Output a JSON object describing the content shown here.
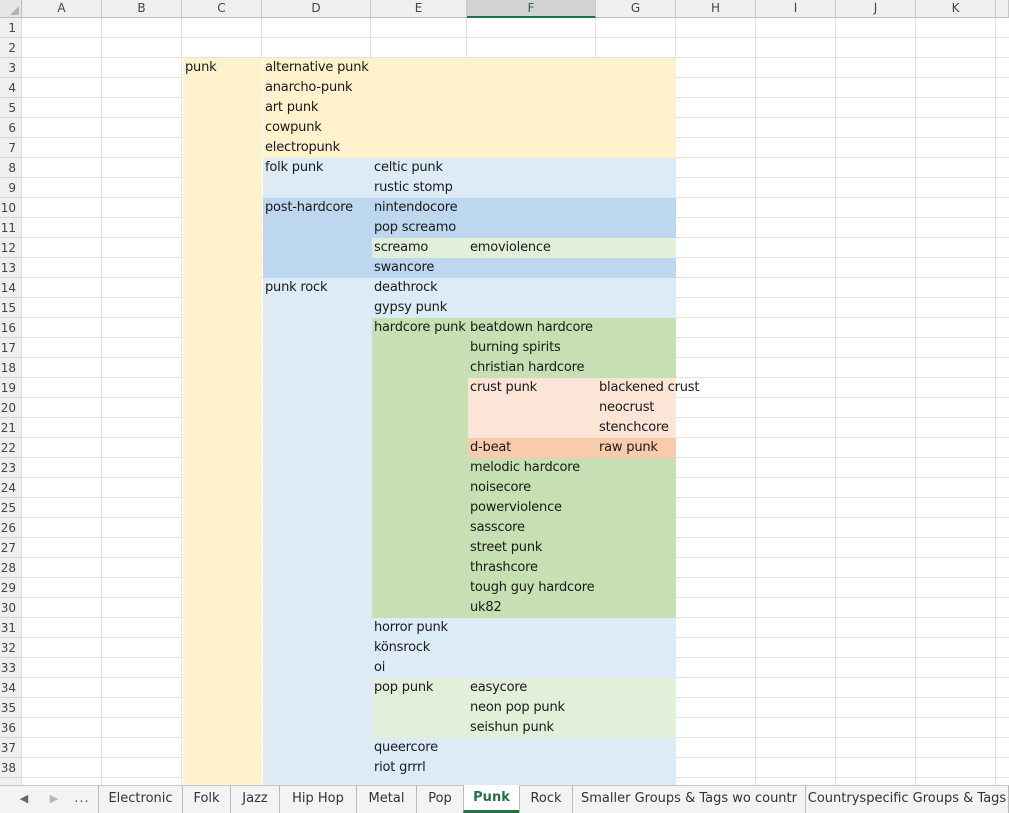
{
  "columns": [
    "A",
    "B",
    "C",
    "D",
    "E",
    "F",
    "G",
    "H",
    "I",
    "J",
    "K"
  ],
  "selected_column": "F",
  "rows": [
    "1",
    "2",
    "3",
    "4",
    "5",
    "6",
    "7",
    "8",
    "9",
    "10",
    "11",
    "12",
    "13",
    "14",
    "15",
    "16",
    "17",
    "18",
    "19",
    "20",
    "21",
    "22",
    "23",
    "24",
    "25",
    "26",
    "27",
    "28",
    "29",
    "30",
    "31",
    "32",
    "33",
    "34",
    "35",
    "36",
    "37",
    "38"
  ],
  "colors": {
    "yellow": "#fff2cc",
    "light_blue": "#ddebf7",
    "mid_blue": "#bdd7ee",
    "light_green": "#e2efda",
    "mid_green": "#c6e0b4",
    "light_orange": "#fce4d6",
    "mid_orange": "#f8cbad",
    "accent": "#217346"
  },
  "cells": [
    {
      "col": "C",
      "row": 3,
      "text": "punk"
    },
    {
      "col": "D",
      "row": 3,
      "text": "alternative punk"
    },
    {
      "col": "D",
      "row": 4,
      "text": "anarcho-punk"
    },
    {
      "col": "D",
      "row": 5,
      "text": "art punk"
    },
    {
      "col": "D",
      "row": 6,
      "text": "cowpunk"
    },
    {
      "col": "D",
      "row": 7,
      "text": "electropunk"
    },
    {
      "col": "D",
      "row": 8,
      "text": "folk punk"
    },
    {
      "col": "E",
      "row": 8,
      "text": "celtic punk"
    },
    {
      "col": "E",
      "row": 9,
      "text": "rustic stomp"
    },
    {
      "col": "D",
      "row": 10,
      "text": "post-hardcore"
    },
    {
      "col": "E",
      "row": 10,
      "text": "nintendocore"
    },
    {
      "col": "E",
      "row": 11,
      "text": "pop screamo"
    },
    {
      "col": "E",
      "row": 12,
      "text": "screamo"
    },
    {
      "col": "F",
      "row": 12,
      "text": "emoviolence"
    },
    {
      "col": "E",
      "row": 13,
      "text": "swancore"
    },
    {
      "col": "D",
      "row": 14,
      "text": "punk rock"
    },
    {
      "col": "E",
      "row": 14,
      "text": "deathrock"
    },
    {
      "col": "E",
      "row": 15,
      "text": "gypsy punk"
    },
    {
      "col": "E",
      "row": 16,
      "text": "hardcore punk"
    },
    {
      "col": "F",
      "row": 16,
      "text": "beatdown hardcore"
    },
    {
      "col": "F",
      "row": 17,
      "text": "burning spirits"
    },
    {
      "col": "F",
      "row": 18,
      "text": "christian hardcore"
    },
    {
      "col": "F",
      "row": 19,
      "text": "crust punk"
    },
    {
      "col": "G",
      "row": 19,
      "text": "blackened crust"
    },
    {
      "col": "G",
      "row": 20,
      "text": "neocrust"
    },
    {
      "col": "G",
      "row": 21,
      "text": "stenchcore"
    },
    {
      "col": "F",
      "row": 22,
      "text": "d-beat"
    },
    {
      "col": "G",
      "row": 22,
      "text": "raw punk"
    },
    {
      "col": "F",
      "row": 23,
      "text": "melodic hardcore"
    },
    {
      "col": "F",
      "row": 24,
      "text": "noisecore"
    },
    {
      "col": "F",
      "row": 25,
      "text": "powerviolence"
    },
    {
      "col": "F",
      "row": 26,
      "text": "sasscore"
    },
    {
      "col": "F",
      "row": 27,
      "text": "street punk"
    },
    {
      "col": "F",
      "row": 28,
      "text": "thrashcore"
    },
    {
      "col": "F",
      "row": 29,
      "text": "tough guy hardcore"
    },
    {
      "col": "F",
      "row": 30,
      "text": "uk82"
    },
    {
      "col": "E",
      "row": 31,
      "text": "horror punk"
    },
    {
      "col": "E",
      "row": 32,
      "text": "könsrock"
    },
    {
      "col": "E",
      "row": 33,
      "text": "oi"
    },
    {
      "col": "E",
      "row": 34,
      "text": "pop punk"
    },
    {
      "col": "F",
      "row": 34,
      "text": "easycore"
    },
    {
      "col": "F",
      "row": 35,
      "text": "neon pop punk"
    },
    {
      "col": "F",
      "row": 36,
      "text": "seishun punk"
    },
    {
      "col": "E",
      "row": 37,
      "text": "queercore"
    },
    {
      "col": "E",
      "row": 38,
      "text": "riot grrrl"
    }
  ],
  "fills": [
    {
      "cols": [
        "C",
        "C"
      ],
      "rows": [
        3,
        40
      ],
      "color": "yellow"
    },
    {
      "cols": [
        "D",
        "G"
      ],
      "rows": [
        3,
        7
      ],
      "color": "yellow"
    },
    {
      "cols": [
        "D",
        "G"
      ],
      "rows": [
        8,
        9
      ],
      "color": "light_blue"
    },
    {
      "cols": [
        "D",
        "G"
      ],
      "rows": [
        10,
        13
      ],
      "color": "mid_blue"
    },
    {
      "cols": [
        "E",
        "G"
      ],
      "rows": [
        12,
        12
      ],
      "color": "light_green"
    },
    {
      "cols": [
        "D",
        "G"
      ],
      "rows": [
        14,
        40
      ],
      "color": "light_blue"
    },
    {
      "cols": [
        "E",
        "G"
      ],
      "rows": [
        16,
        30
      ],
      "color": "mid_green"
    },
    {
      "cols": [
        "F",
        "G"
      ],
      "rows": [
        19,
        21
      ],
      "color": "light_orange"
    },
    {
      "cols": [
        "F",
        "G"
      ],
      "rows": [
        22,
        22
      ],
      "color": "mid_orange"
    },
    {
      "cols": [
        "E",
        "G"
      ],
      "rows": [
        34,
        36
      ],
      "color": "light_green"
    }
  ],
  "tabs": [
    {
      "label": "Electronic",
      "active": false
    },
    {
      "label": "Folk",
      "active": false
    },
    {
      "label": "Jazz",
      "active": false
    },
    {
      "label": "Hip Hop",
      "active": false
    },
    {
      "label": "Metal",
      "active": false
    },
    {
      "label": "Pop",
      "active": false
    },
    {
      "label": "Punk",
      "active": true
    },
    {
      "label": "Rock",
      "active": false
    },
    {
      "label": "Smaller Groups & Tags wo countr",
      "active": false
    },
    {
      "label": "Countryspecific Groups & Tags",
      "active": false
    }
  ],
  "nav": {
    "prev": "◀",
    "next": "▶",
    "more": "..."
  }
}
